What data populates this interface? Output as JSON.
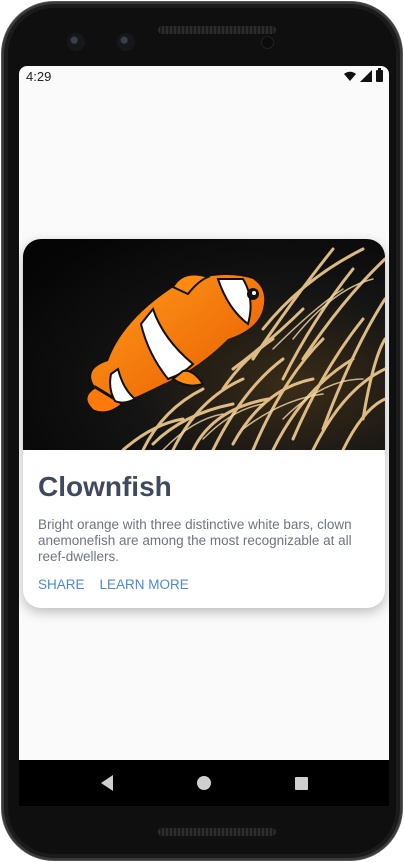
{
  "statusbar": {
    "time": "4:29",
    "icons": [
      "wifi-icon",
      "signal-icon",
      "battery-icon"
    ]
  },
  "card": {
    "image_alt": "clownfish-photo",
    "title": "Clownfish",
    "description": "Bright orange with three distinctive white bars, clown anemonefish are among the most recognizable at all reef-dwellers.",
    "actions": {
      "share": "SHARE",
      "learn_more": "LEARN MORE"
    }
  },
  "navbar": {
    "icons": [
      "back-icon",
      "home-icon",
      "recent-apps-icon"
    ]
  },
  "colors": {
    "title": "#404a5d",
    "body": "#6e7485",
    "accent": "#4d88d8",
    "screen_bg": "#fafafa"
  }
}
